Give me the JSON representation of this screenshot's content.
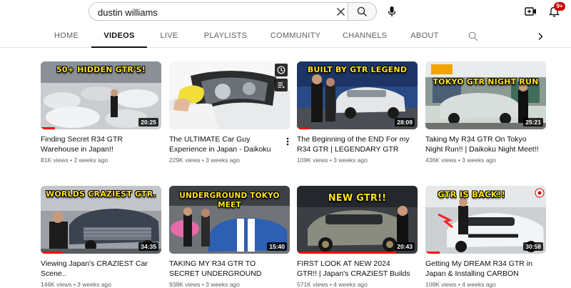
{
  "search": {
    "query": "dustin williams"
  },
  "notifications": {
    "count": "9+"
  },
  "tabs": [
    {
      "label": "HOME"
    },
    {
      "label": "VIDEOS"
    },
    {
      "label": "LIVE"
    },
    {
      "label": "PLAYLISTS"
    },
    {
      "label": "COMMUNITY"
    },
    {
      "label": "CHANNELS"
    },
    {
      "label": "ABOUT"
    }
  ],
  "active_tab": "VIDEOS",
  "colors": {
    "accent_red": "#ff0000",
    "badge_red": "#cc0000",
    "overlay_yellow": "#ffe21a"
  },
  "videos": [
    {
      "overlay": "50+ HIDDEN GTR'S!",
      "duration": "20:25",
      "title": "Finding Secret R34 GTR Warehouse in Japan!!",
      "meta": "81K views • 2 weeks ago",
      "progress": 0.12
    },
    {
      "overlay": "",
      "duration": "",
      "title": "The ULTIMATE Car Guy Experience in Japan - Daikoku Car Meet &...",
      "meta": "229K views • 3 weeks ago",
      "progress": 0
    },
    {
      "overlay": "BUILT BY GTR LEGEND",
      "duration": "28:09",
      "title": "The Beginning of the END For my R34 GTR | LEGENDARY GTR Shop",
      "meta": "109K views • 3 weeks ago",
      "progress": 0.1
    },
    {
      "overlay": "TOKYO GTR NIGHT RUN",
      "duration": "25:21",
      "title": "Taking My R34 GTR On Tokyo Night Run!! | Daikoku Night Meet!!",
      "meta": "436K views • 3 weeks ago",
      "progress": 0
    },
    {
      "overlay": "WORLDS CRAZIEST GTR.",
      "duration": "34:35",
      "title": "Viewing Japan's CRAZIEST Car Scene..",
      "meta": "146K views • 3 weeks ago",
      "progress": 0.18
    },
    {
      "overlay": "UNDERGROUND TOKYO MEET",
      "duration": "15:40",
      "title": "TAKING MY R34 GTR TO SECRET UNDERGROUND TOKYO CAR MEE...",
      "meta": "938K views • 3 weeks ago",
      "progress": 0
    },
    {
      "overlay": "NEW GTR!!",
      "duration": "20:43",
      "title": "FIRST LOOK AT NEW 2024 GTR!! | Japan's CRAZIEST Builds",
      "meta": "571K views • 4 weeks ago",
      "progress": 0.82
    },
    {
      "overlay": "GTR IS BACK!!",
      "duration": "30:58",
      "title": "Getting My DREAM R34 GTR in Japan & Installing CARBON FIBER...",
      "meta": "108K views • 4 weeks ago",
      "progress": 0.12
    }
  ]
}
